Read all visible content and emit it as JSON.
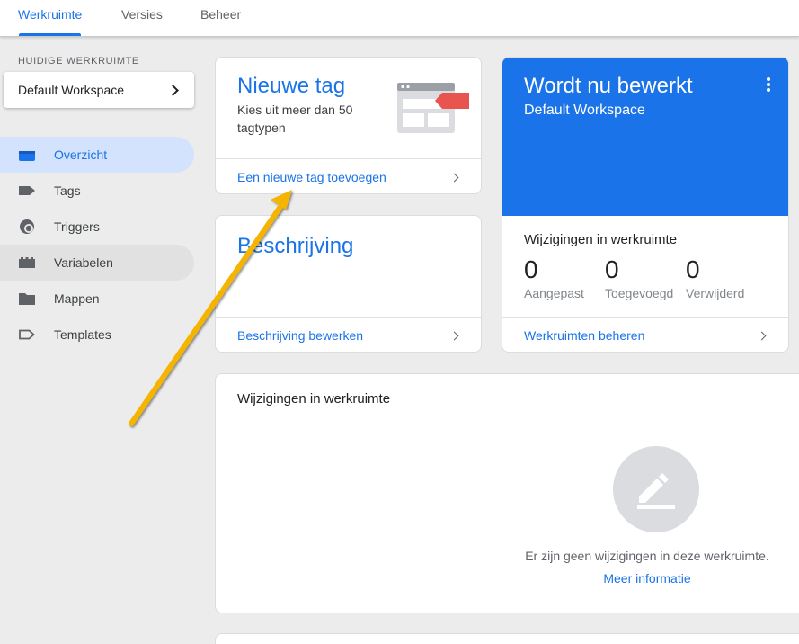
{
  "tabs": [
    {
      "label": "Werkruimte",
      "active": true
    },
    {
      "label": "Versies",
      "active": false
    },
    {
      "label": "Beheer",
      "active": false
    }
  ],
  "sidebar": {
    "workspace_caption": "HUIDIGE WERKRUIMTE",
    "workspace_name": "Default Workspace",
    "items": [
      {
        "label": "Overzicht",
        "icon": "overview-icon"
      },
      {
        "label": "Tags",
        "icon": "tag-icon"
      },
      {
        "label": "Triggers",
        "icon": "trigger-icon"
      },
      {
        "label": "Variabelen",
        "icon": "variables-icon"
      },
      {
        "label": "Mappen",
        "icon": "folder-icon"
      },
      {
        "label": "Templates",
        "icon": "template-icon"
      }
    ]
  },
  "new_tag_card": {
    "title": "Nieuwe tag",
    "description": "Kies uit meer dan 50 tagtypen",
    "link": "Een nieuwe tag toevoegen"
  },
  "description_card": {
    "title": "Beschrijving",
    "link": "Beschrijving bewerken"
  },
  "editing_card": {
    "title": "Wordt nu bewerkt",
    "workspace": "Default Workspace",
    "changes_heading": "Wijzigingen in werkruimte",
    "stats": [
      {
        "value": "0",
        "label": "Aangepast"
      },
      {
        "value": "0",
        "label": "Toegevoegd"
      },
      {
        "value": "0",
        "label": "Verwijderd"
      }
    ],
    "link": "Werkruimten beheren"
  },
  "changes_card": {
    "title": "Wijzigingen in werkruimte",
    "empty_text": "Er zijn geen wijzigingen in deze werkruimte.",
    "more_link": "Meer informatie"
  },
  "colors": {
    "accent": "#1a73e8",
    "arrow": "#f4b400",
    "tag_red": "#e8554e"
  }
}
